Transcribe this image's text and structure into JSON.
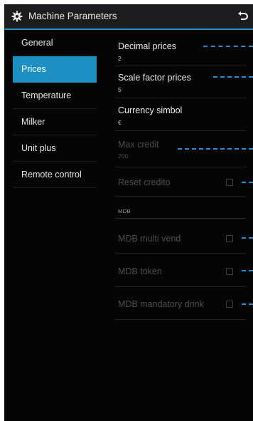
{
  "window": {
    "title": "Machine Parameters",
    "back_icon": "back-arrow-icon",
    "settings_icon": "gear-icon"
  },
  "colors": {
    "accent": "#1e8fc2",
    "background": "#050506",
    "titlebar": "#1c1c1e",
    "callout": "#2a8fd0"
  },
  "sidebar": {
    "items": [
      {
        "label": "General",
        "active": false
      },
      {
        "label": "Prices",
        "active": true
      },
      {
        "label": "Temperature",
        "active": false
      },
      {
        "label": "Milker",
        "active": false
      },
      {
        "label": "Unit plus",
        "active": false
      },
      {
        "label": "Remote control",
        "active": false
      }
    ]
  },
  "prices": {
    "decimal_prices": {
      "label": "Decimal prices",
      "value": "2"
    },
    "scale_factor_prices": {
      "label": "Scale factor prices",
      "value": "5"
    },
    "currency_symbol": {
      "label": "Currency simbol",
      "value": "€"
    },
    "max_credit": {
      "label": "Max credit",
      "value": "200",
      "enabled": false
    },
    "reset_credito": {
      "label": "Reset credito",
      "checked": false,
      "enabled": false
    },
    "mdb_section": "MDB",
    "mdb_multi_vend": {
      "label": "MDB multi vend",
      "checked": false,
      "enabled": false
    },
    "mdb_token": {
      "label": "MDB token",
      "checked": false,
      "enabled": false
    },
    "mdb_mandatory_drink": {
      "label": "MDB mandatory drink",
      "checked": false,
      "enabled": false
    }
  }
}
